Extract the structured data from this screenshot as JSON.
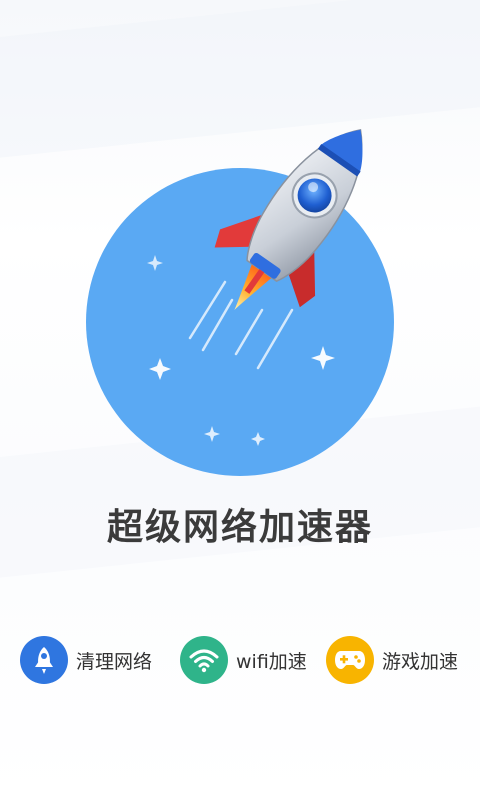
{
  "app": {
    "title": "超级网络加速器"
  },
  "features": [
    {
      "label": "清理网络",
      "icon": "rocket-icon",
      "color": "#2f76e0"
    },
    {
      "label": "wifi加速",
      "icon": "wifi-icon",
      "color": "#2fb48a"
    },
    {
      "label": "游戏加速",
      "icon": "gamepad-icon",
      "color": "#f8b400"
    }
  ],
  "colors": {
    "hero_circle": "#5aa9f3",
    "rocket_body": "#d8dde4",
    "rocket_fin": "#e23a3a",
    "rocket_window": "#2f6ee0",
    "flame": "#ffb02e"
  }
}
